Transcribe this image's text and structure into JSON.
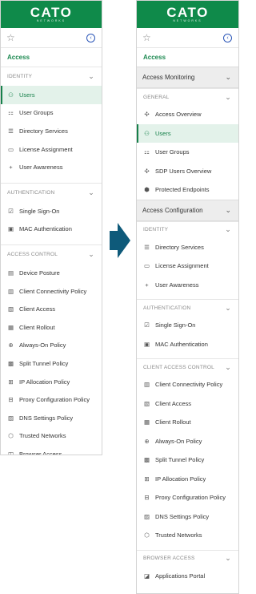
{
  "brand": {
    "word": "CATO",
    "sub": "NETWORKS"
  },
  "icons": {
    "star": "star-icon",
    "collapse": "chevron-left-circle-icon",
    "arrow": "right-arrow-icon"
  },
  "colors": {
    "brand_green": "#0f8a4a",
    "active_green": "#16804a",
    "active_bg": "#e3f2ea",
    "arrow": "#0e5a7a"
  },
  "left": {
    "title": "Access",
    "sections": [
      {
        "label": "IDENTITY",
        "items": [
          {
            "label": "Users",
            "icon": "user-icon",
            "active": true
          },
          {
            "label": "User Groups",
            "icon": "user-groups-icon"
          },
          {
            "label": "Directory Services",
            "icon": "directory-icon"
          },
          {
            "label": "License Assignment",
            "icon": "license-icon"
          },
          {
            "label": "User Awareness",
            "icon": "plus-icon"
          }
        ]
      },
      {
        "label": "AUTHENTICATION",
        "items": [
          {
            "label": "Single Sign-On",
            "icon": "checkbox-icon"
          },
          {
            "label": "MAC Authentication",
            "icon": "mac-icon"
          }
        ]
      },
      {
        "label": "ACCESS CONTROL",
        "items": [
          {
            "label": "Device Posture",
            "icon": "device-icon"
          },
          {
            "label": "Client Connectivity Policy",
            "icon": "policy-icon"
          },
          {
            "label": "Client Access",
            "icon": "client-access-icon"
          },
          {
            "label": "Client Rollout",
            "icon": "rollout-icon"
          },
          {
            "label": "Always-On Policy",
            "icon": "lock-icon"
          },
          {
            "label": "Split Tunnel Policy",
            "icon": "grid-icon"
          },
          {
            "label": "IP Allocation Policy",
            "icon": "ip-icon"
          },
          {
            "label": "Proxy Configuration Policy",
            "icon": "proxy-icon"
          },
          {
            "label": "DNS Settings Policy",
            "icon": "dns-icon"
          },
          {
            "label": "Trusted Networks",
            "icon": "trusted-icon"
          },
          {
            "label": "Browser Access",
            "icon": "browser-icon"
          }
        ]
      }
    ]
  },
  "right": {
    "title": "Access",
    "access_monitoring": "Access Monitoring",
    "general": {
      "label": "GENERAL",
      "items": [
        {
          "label": "Access Overview",
          "icon": "sparkle-icon"
        },
        {
          "label": "Users",
          "icon": "user-icon",
          "active": true
        },
        {
          "label": "User Groups",
          "icon": "user-groups-icon"
        },
        {
          "label": "SDP Users Overview",
          "icon": "sparkle-icon"
        },
        {
          "label": "Protected Endpoints",
          "icon": "shield-icon"
        }
      ]
    },
    "access_configuration": "Access Configuration",
    "sections": [
      {
        "label": "IDENTITY",
        "items": [
          {
            "label": "Directory Services",
            "icon": "directory-icon"
          },
          {
            "label": "License Assignment",
            "icon": "license-icon"
          },
          {
            "label": "User Awareness",
            "icon": "plus-icon"
          }
        ]
      },
      {
        "label": "AUTHENTICATION",
        "items": [
          {
            "label": "Single Sign-On",
            "icon": "checkbox-icon"
          },
          {
            "label": "MAC Authentication",
            "icon": "mac-icon"
          }
        ]
      },
      {
        "label": "CLIENT ACCESS CONTROL",
        "items": [
          {
            "label": "Client Connectivity Policy",
            "icon": "policy-icon"
          },
          {
            "label": "Client Access",
            "icon": "client-access-icon"
          },
          {
            "label": "Client Rollout",
            "icon": "rollout-icon"
          },
          {
            "label": "Always-On Policy",
            "icon": "lock-icon"
          },
          {
            "label": "Split Tunnel Policy",
            "icon": "grid-icon"
          },
          {
            "label": "IP Allocation Policy",
            "icon": "ip-icon"
          },
          {
            "label": "Proxy Configuration Policy",
            "icon": "proxy-icon"
          },
          {
            "label": "DNS Settings Policy",
            "icon": "dns-icon"
          },
          {
            "label": "Trusted Networks",
            "icon": "trusted-icon"
          }
        ]
      },
      {
        "label": "BROWSER ACCESS",
        "items": [
          {
            "label": "Applications Portal",
            "icon": "portal-icon"
          }
        ]
      }
    ]
  }
}
